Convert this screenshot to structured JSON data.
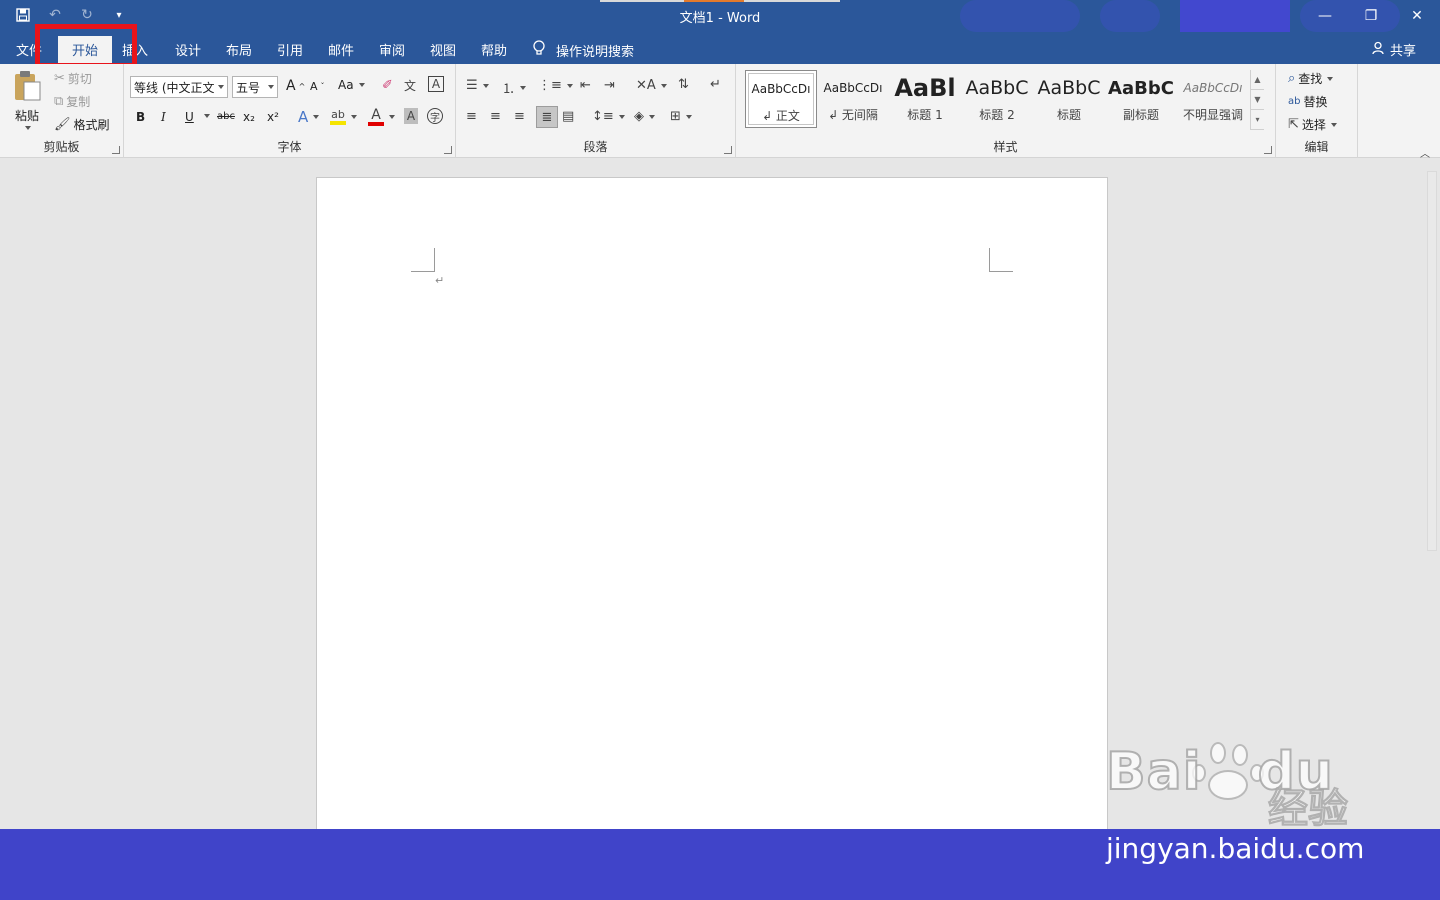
{
  "titlebar": {
    "title": "文档1  -  Word",
    "qat": [
      "save-icon",
      "undo-icon",
      "redo-icon",
      "customize-qat-icon"
    ],
    "window_controls": [
      "minimize-icon",
      "restore-icon",
      "close-icon"
    ]
  },
  "tabs": {
    "file": "文件",
    "home": "开始",
    "insert": "插入",
    "design": "设计",
    "layout": "布局",
    "references": "引用",
    "mailings": "邮件",
    "review": "审阅",
    "view": "视图",
    "help": "帮助",
    "tell_me": "操作说明搜索",
    "share": "共享"
  },
  "clipboard": {
    "paste": "粘贴",
    "cut": "剪切",
    "copy": "复制",
    "format_painter": "格式刷",
    "label": "剪贴板"
  },
  "font": {
    "family": "等线 (中文正文",
    "size": "五号",
    "grow": "A",
    "shrink": "A",
    "change_case": "Aa",
    "bold": "B",
    "italic": "I",
    "underline": "U",
    "strike": "abc",
    "subscript": "x₂",
    "superscript": "x²",
    "label": "字体",
    "highlight_color": "#f5e400",
    "font_color": "#e00000"
  },
  "paragraph": {
    "label": "段落"
  },
  "styles": {
    "label": "样式",
    "items": [
      {
        "sample": "AaBbCcDı",
        "name": "↲ 正文"
      },
      {
        "sample": "AaBbCcDı",
        "name": "↲ 无间隔"
      },
      {
        "sample": "AaBl",
        "name": "标题 1"
      },
      {
        "sample": "AaBbC",
        "name": "标题 2"
      },
      {
        "sample": "AaBbC",
        "name": "标题"
      },
      {
        "sample": "AaBbC",
        "name": "副标题"
      },
      {
        "sample": "AaBbCcDı",
        "name": "不明显强调"
      }
    ]
  },
  "editing": {
    "find": "查找",
    "replace": "替换",
    "select": "选择",
    "label": "编辑"
  },
  "document": {
    "paragraph_mark": "↵"
  },
  "watermark": {
    "logo": "Bai",
    "logo2": "du",
    "cn": "经验",
    "url": "jingyan.baidu.com"
  },
  "colors": {
    "title_bar": "#2b579a",
    "highlight_box": "#e8141b",
    "footer_band": "#4044c9"
  }
}
